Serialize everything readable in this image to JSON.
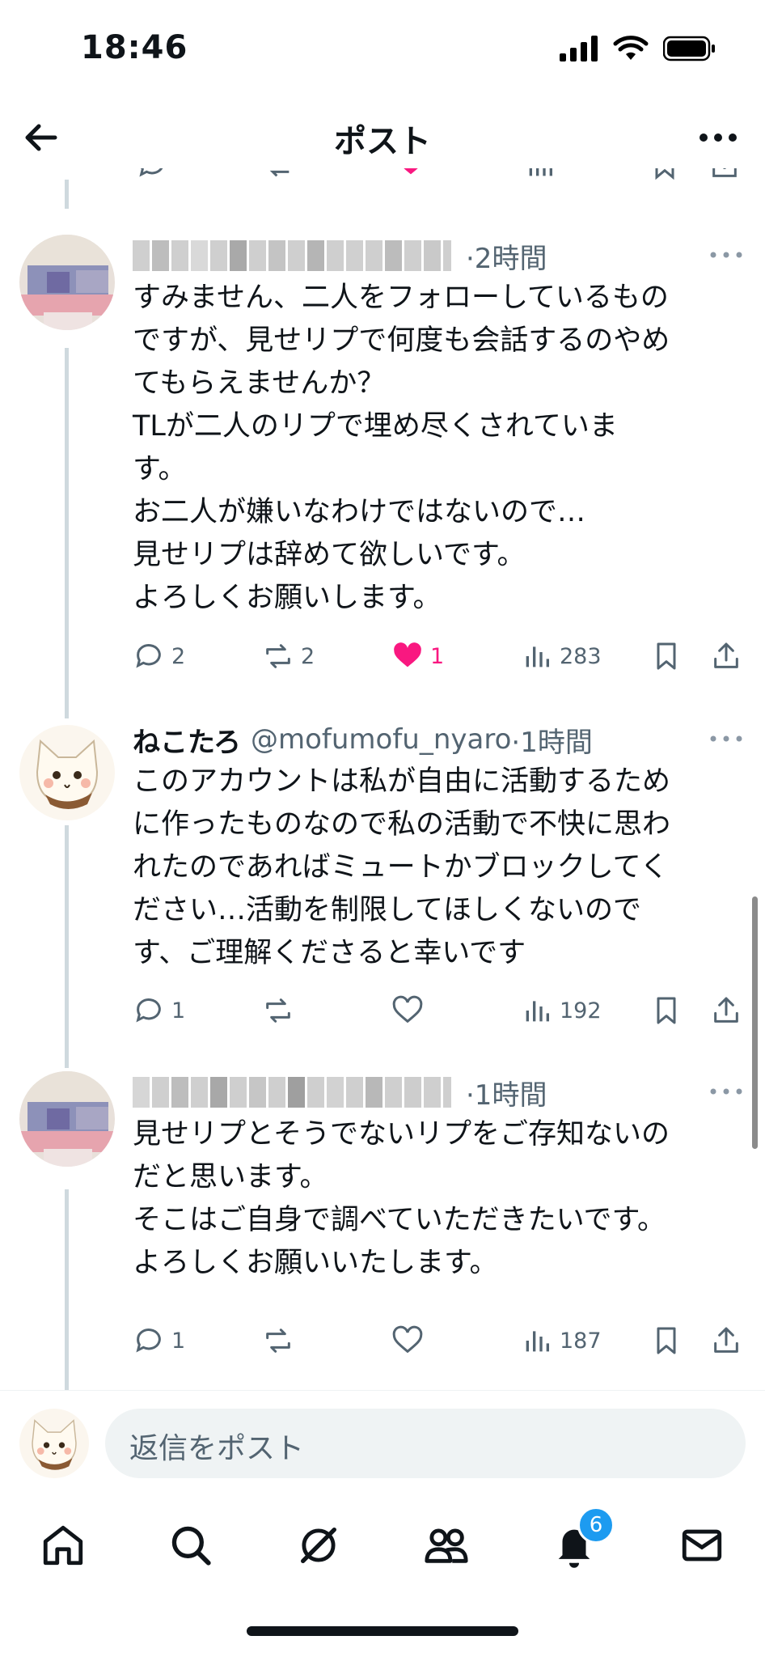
{
  "status_bar": {
    "time": "18:46"
  },
  "header": {
    "title": "ポスト"
  },
  "posts": [
    {
      "display_name": "",
      "handle": "",
      "time": "·2時間",
      "text": "すみません、二人をフォローしているもの\nですが、見せリプで何度も会話するのやめ\nてもらえませんか？\nTLが二人のリプで埋め尽くされていま\nす。\nお二人が嫌いなわけではないので…\n見せリプは辞めて欲しいです。\nよろしくお願いします。",
      "replies": "2",
      "reposts": "2",
      "likes": "1",
      "views": "283",
      "liked": true
    },
    {
      "display_name": "ねこたろ",
      "handle": "@mofumofu_nyaro",
      "time": "·1時間",
      "text": "このアカウントは私が自由に活動するため\nに作ったものなので私の活動で不快に思わ\nれたのであればミュートかブロックしてく\nださい…活動を制限してほしくないので\nす、ご理解くださると幸いです",
      "replies": "1",
      "reposts": "",
      "likes": "",
      "views": "192",
      "liked": false
    },
    {
      "display_name": "",
      "handle": "",
      "time": "·1時間",
      "text": "見せリプとそうでないリプをご存知ないの\nだと思います。\nそこはご自身で調べていただきたいです。\nよろしくお願いいたします。",
      "replies": "1",
      "reposts": "",
      "likes": "",
      "views": "187",
      "liked": false
    }
  ],
  "reply_bar": {
    "placeholder": "返信をポスト"
  },
  "tab_bar": {
    "notification_badge": "6"
  },
  "colors": {
    "like": "#f91880",
    "accent": "#1d9bf0",
    "text": "#0f1419",
    "secondary": "#536471"
  },
  "icons": [
    "back-arrow-icon",
    "more-icon",
    "reply-icon",
    "repost-icon",
    "like-icon",
    "views-icon",
    "bookmark-icon",
    "share-icon",
    "home-icon",
    "search-icon",
    "grok-icon",
    "communities-icon",
    "bell-icon",
    "mail-icon"
  ]
}
